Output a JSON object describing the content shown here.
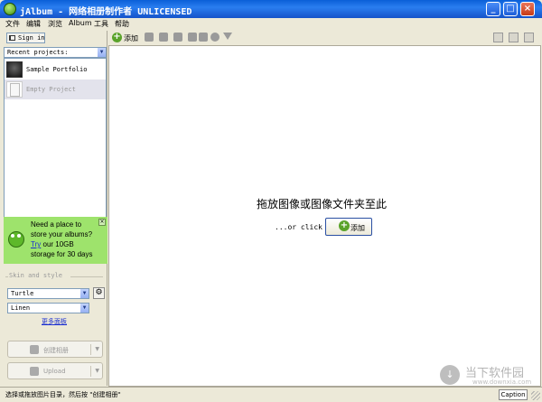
{
  "window": {
    "title": "jAlbum - 网络相册制作者 UNLICENSED",
    "buttons": {
      "minimize": "_",
      "maximize": "□",
      "close": "×"
    }
  },
  "menu": [
    "文件",
    "编辑",
    "浏览",
    "Album",
    "工具",
    "帮助"
  ],
  "sidebar": {
    "sign_in": "Sign in",
    "recent_label": "Recent projects:",
    "projects": [
      {
        "name": "Sample Portfolio",
        "icon": "photo-thumbnail-icon"
      },
      {
        "name": "Empty Project",
        "icon": "blank-page-icon"
      }
    ],
    "promo": {
      "line1": "Need a place to",
      "line2": "store your albums?",
      "try_link": "Try",
      "line3_rest": " our 10GB",
      "line4": "storage for 30 days",
      "close": "×"
    },
    "skin_section": "Skin and style",
    "skin": "Turtle",
    "style": "Linen",
    "more_panels": "更多面板",
    "make_album": "创建相册",
    "upload": "Upload"
  },
  "toolbar": {
    "add": "添加"
  },
  "main": {
    "drop_text": "拖放图像或图像文件夹至此",
    "or_click": "...or click",
    "add_button": "添加"
  },
  "watermark": {
    "big": "当下软件园",
    "small": "www.downxia.com",
    "glyph": "↓"
  },
  "status": {
    "text": "选择或拖放图片目录，然后按 \"创建相册\"",
    "caption": "Caption"
  }
}
